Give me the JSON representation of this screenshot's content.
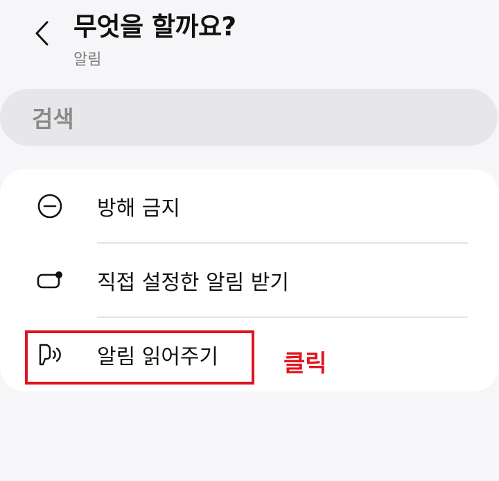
{
  "header": {
    "title": "무엇을 할까요?",
    "subtitle": "알림"
  },
  "search": {
    "placeholder": "검색"
  },
  "options": [
    {
      "label": "방해 금지",
      "icon": "do-not-disturb-icon"
    },
    {
      "label": "직접 설정한 알림 받기",
      "icon": "custom-notification-icon"
    },
    {
      "label": "알림 읽어주기",
      "icon": "read-aloud-icon"
    }
  ],
  "annotation": {
    "text": "클릭",
    "color": "#e0141e"
  }
}
